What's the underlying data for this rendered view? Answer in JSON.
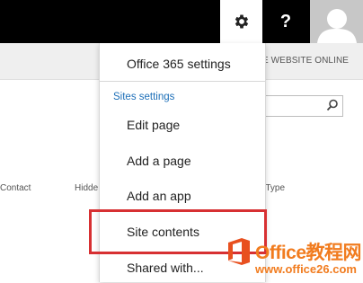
{
  "topbar": {
    "help_label": "?",
    "icons": [
      "gear-icon",
      "help-icon",
      "avatar-icon"
    ]
  },
  "subbar": {
    "right_text": "E WEBSITE ONLINE"
  },
  "search": {
    "placeholder": ""
  },
  "columns": [
    {
      "label": "Contact"
    },
    {
      "label": "Hidde"
    },
    {
      "label": "t Type"
    }
  ],
  "menu": {
    "office_settings": "Office 365 settings",
    "section_label": "Sites settings",
    "items": [
      {
        "label": "Edit page"
      },
      {
        "label": "Add a page"
      },
      {
        "label": "Add an app"
      },
      {
        "label": "Site contents"
      },
      {
        "label": "Shared with..."
      }
    ]
  },
  "highlight": {
    "color": "#d73032",
    "target": "Site contents"
  },
  "watermark": {
    "title": "Office教程网",
    "url": "www.office26.com"
  }
}
